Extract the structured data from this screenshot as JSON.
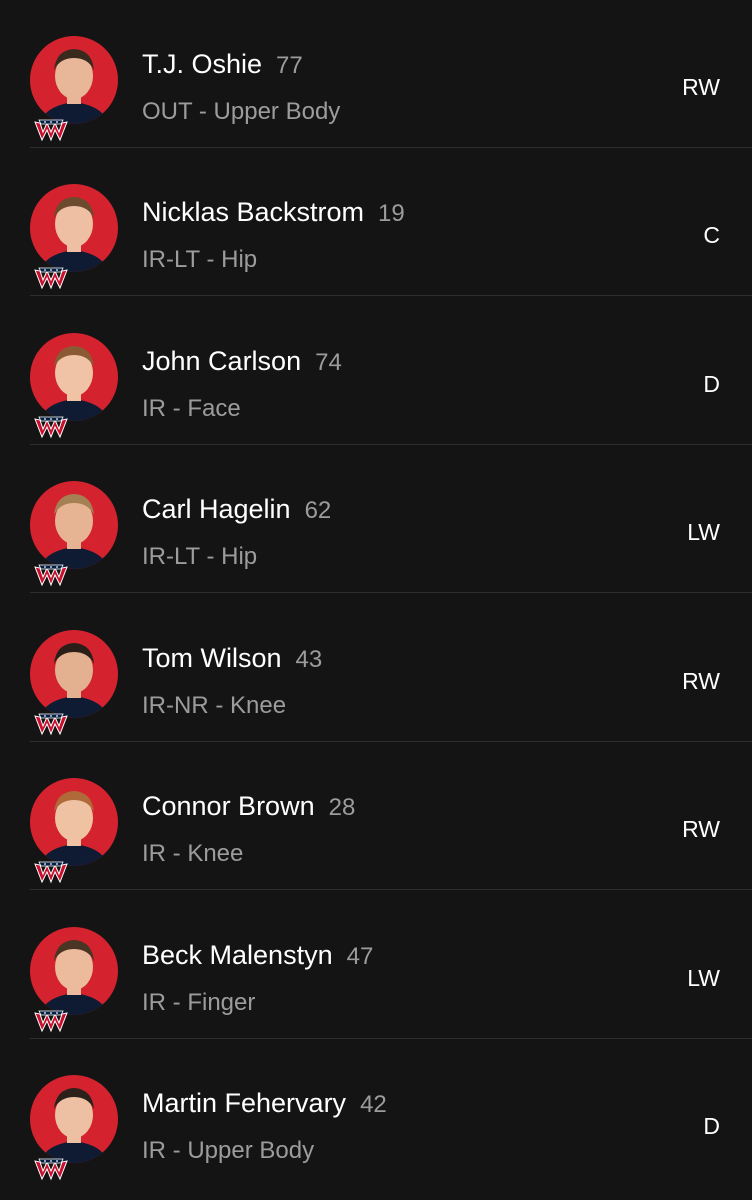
{
  "roster": {
    "players": [
      {
        "name": "T.J. Oshie",
        "number": "77",
        "status": "OUT - Upper Body",
        "position": "RW",
        "hair": "#3a2a1e",
        "skin": "#e8b79a"
      },
      {
        "name": "Nicklas Backstrom",
        "number": "19",
        "status": "IR-LT - Hip",
        "position": "C",
        "hair": "#6b4a2e",
        "skin": "#eebfa3"
      },
      {
        "name": "John Carlson",
        "number": "74",
        "status": "IR - Face",
        "position": "D",
        "hair": "#8a5a34",
        "skin": "#f0c3a6"
      },
      {
        "name": "Carl Hagelin",
        "number": "62",
        "status": "IR-LT - Hip",
        "position": "LW",
        "hair": "#a68055",
        "skin": "#e6b493"
      },
      {
        "name": "Tom Wilson",
        "number": "43",
        "status": "IR-NR - Knee",
        "position": "RW",
        "hair": "#2a1f18",
        "skin": "#e3b090"
      },
      {
        "name": "Connor Brown",
        "number": "28",
        "status": "IR - Knee",
        "position": "RW",
        "hair": "#b06a3a",
        "skin": "#f0c2a4"
      },
      {
        "name": "Beck Malenstyn",
        "number": "47",
        "status": "IR - Finger",
        "position": "LW",
        "hair": "#4a3424",
        "skin": "#ecbb9e"
      },
      {
        "name": "Martin Fehervary",
        "number": "42",
        "status": "IR - Upper Body",
        "position": "D",
        "hair": "#2b211a",
        "skin": "#edc0a4"
      }
    ]
  },
  "colors": {
    "background": "#141414",
    "avatar_bg": "#d4232f",
    "secondary_text": "#9c9c9c",
    "team_red": "#c8102e",
    "team_navy": "#041e42"
  },
  "icons": {
    "team_logo": "capitals-logo-icon"
  }
}
